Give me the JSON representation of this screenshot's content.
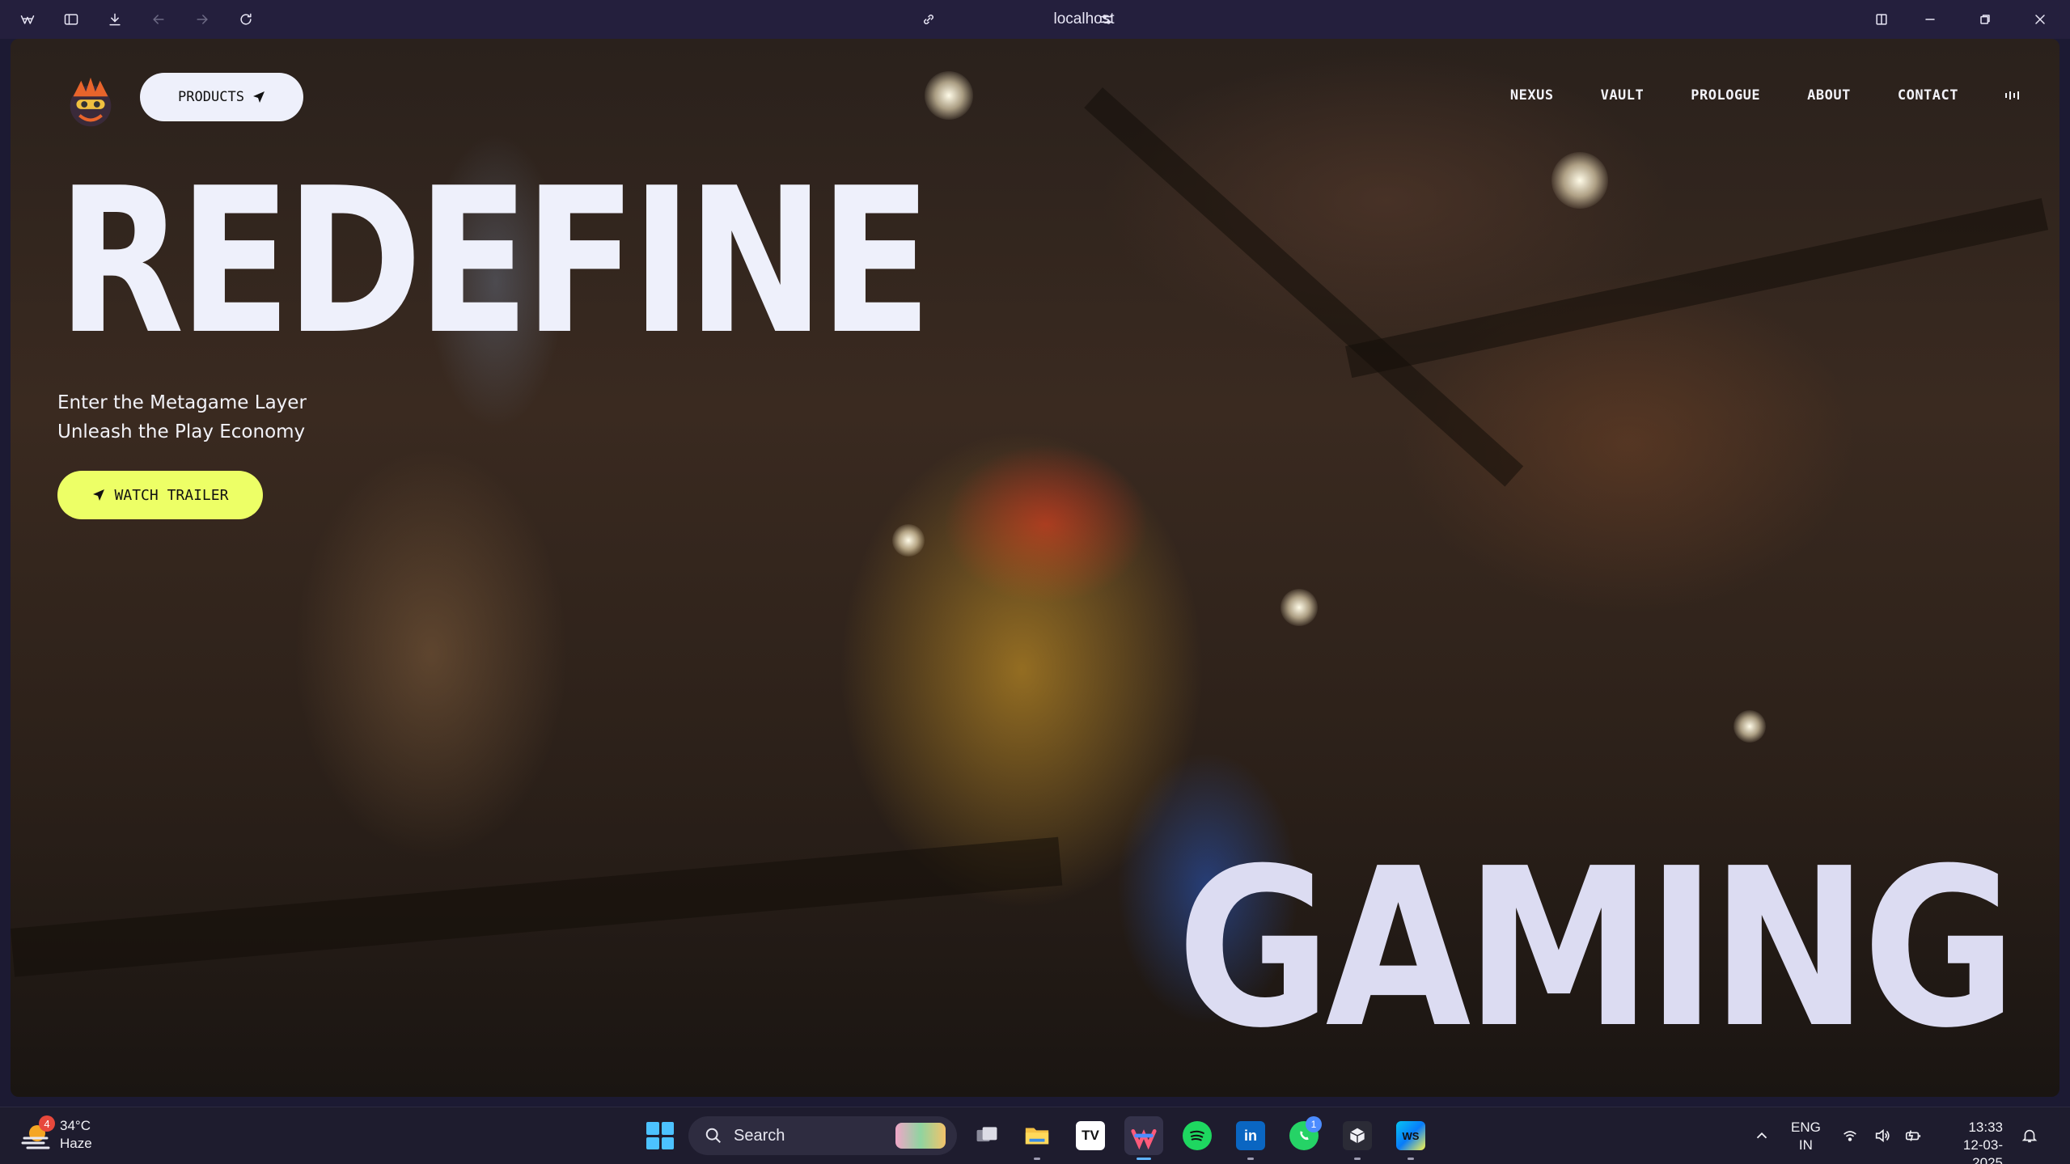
{
  "browser": {
    "url": "localhost"
  },
  "site": {
    "products_label": "PRODUCTS",
    "nav": [
      "NEXUS",
      "VAULT",
      "PROLOGUE",
      "ABOUT",
      "CONTACT"
    ],
    "headline": "REDEFINE",
    "tagline_line1": "Enter the Metagame Layer",
    "tagline_line2": "Unleash the Play Economy",
    "cta_label": "WATCH TRAILER",
    "footer_word": "GAMING",
    "accent_color": "#edff66",
    "button_color": "#eef0fb"
  },
  "taskbar": {
    "weather": {
      "temp": "34°C",
      "condition": "Haze",
      "badge": "4"
    },
    "search_placeholder": "Search",
    "whatsapp_badge": "1",
    "language_line1": "ENG",
    "language_line2": "IN",
    "time": "13:33",
    "date": "12-03-2025"
  }
}
